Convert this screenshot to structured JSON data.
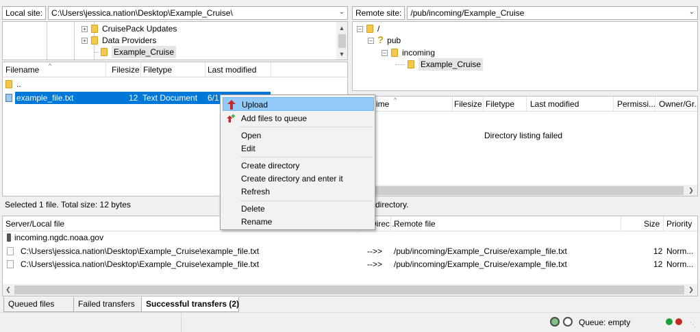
{
  "local": {
    "site_label": "Local site:",
    "path": "C:\\Users\\jessica.nation\\Desktop\\Example_Cruise\\",
    "tree": [
      "CruisePack Updates",
      "Data Providers",
      "Example_Cruise"
    ],
    "columns": [
      "Filename",
      "Filesize",
      "Filetype",
      "Last modified"
    ],
    "files": [
      {
        "name": "..",
        "size": "",
        "type": "",
        "modified": ""
      },
      {
        "name": "example_file.txt",
        "size": "12",
        "type": "Text Document",
        "modified": "6/1"
      }
    ],
    "status": "Selected 1 file. Total size: 12 bytes"
  },
  "remote": {
    "site_label": "Remote site:",
    "path": "/pub/incoming/Example_Cruise",
    "tree": [
      "/",
      "pub",
      "incoming",
      "Example_Cruise"
    ],
    "columns": [
      "ime",
      "Filesize",
      "Filetype",
      "Last modified",
      "Permissi...",
      "Owner/Gr..."
    ],
    "message": "Directory listing failed",
    "status": "directory."
  },
  "context_menu": {
    "items": [
      "Upload",
      "Add files to queue",
      "Open",
      "Edit",
      "Create directory",
      "Create directory and enter it",
      "Refresh",
      "Delete",
      "Rename"
    ]
  },
  "queue": {
    "columns": [
      "Server/Local file",
      "Direc...",
      "Remote file",
      "Size",
      "Priority"
    ],
    "server": "incoming.ngdc.noaa.gov",
    "rows": [
      {
        "local": "C:\\Users\\jessica.nation\\Desktop\\Example_Cruise\\example_file.txt",
        "dir": "-->>",
        "remote": "/pub/incoming/Example_Cruise/example_file.txt",
        "size": "12",
        "priority": "Norm..."
      },
      {
        "local": "C:\\Users\\jessica.nation\\Desktop\\Example_Cruise\\example_file.txt",
        "dir": "-->>",
        "remote": "/pub/incoming/Example_Cruise/example_file.txt",
        "size": "12",
        "priority": "Norm..."
      }
    ]
  },
  "tabs": [
    "Queued files",
    "Failed transfers",
    "Successful transfers (2)"
  ],
  "statusbar": {
    "queue": "Queue: empty"
  },
  "colors": {
    "selection": "#0078d7",
    "menu_highlight": "#91c9f7",
    "folder": "#f2c94c",
    "led_green": "#1e9e3a",
    "led_red": "#c62828"
  }
}
